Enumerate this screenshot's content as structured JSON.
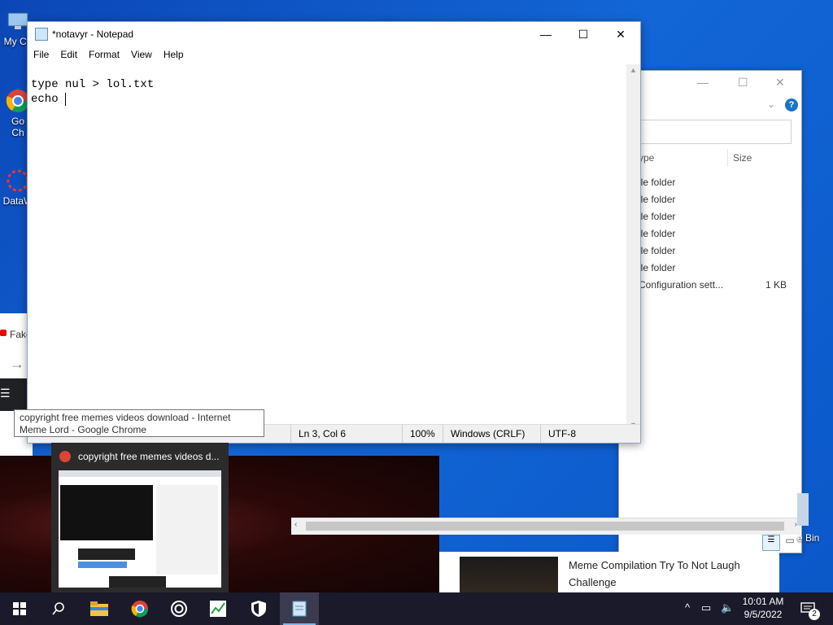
{
  "desktop": {
    "icons": [
      {
        "label": "My Co"
      },
      {
        "label": "Go\nCh"
      },
      {
        "label": "DataW"
      }
    ]
  },
  "chrome_tab": {
    "label": "Fake"
  },
  "notepad": {
    "title": "*notavyr - Notepad",
    "menu": [
      "File",
      "Edit",
      "Format",
      "View",
      "Help"
    ],
    "content": "type nul > lol.txt\necho ",
    "status": {
      "position": "Ln 3, Col 6",
      "zoom": "100%",
      "line_ending": "Windows (CRLF)",
      "encoding": "UTF-8"
    }
  },
  "explorer": {
    "columns": {
      "type": "ype",
      "size": "Size"
    },
    "rows": [
      {
        "type": "ile folder",
        "size": ""
      },
      {
        "type": "ile folder",
        "size": ""
      },
      {
        "type": "ile folder",
        "size": ""
      },
      {
        "type": "ile folder",
        "size": ""
      },
      {
        "type": "ile folder",
        "size": ""
      },
      {
        "type": "ile folder",
        "size": ""
      },
      {
        "type": "Configuration sett...",
        "size": "1 KB"
      }
    ]
  },
  "tooltip": {
    "text": "copyright free memes videos download - Internet Meme Lord - Google Chrome"
  },
  "preview": {
    "title": "copyright free memes videos d..."
  },
  "youtube_card": {
    "title": "Meme Compilation Try To Not Laugh Challenge"
  },
  "recycle_bin": {
    "label": "e Bin"
  },
  "tray": {
    "time": "10:01 AM",
    "date": "9/5/2022",
    "notifications": "2"
  }
}
